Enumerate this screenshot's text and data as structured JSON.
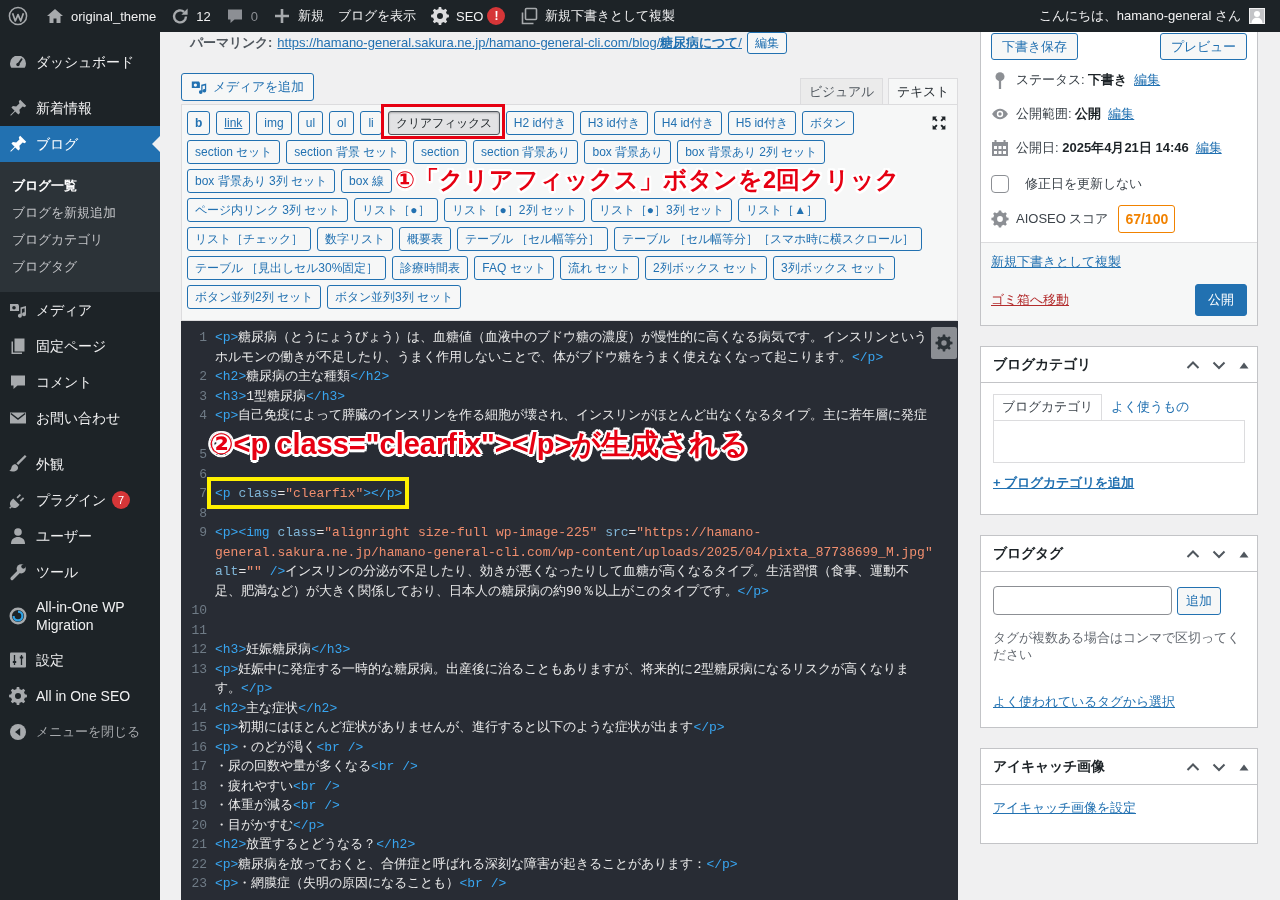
{
  "admin_bar": {
    "site_name": "original_theme",
    "updates": "12",
    "comments": "0",
    "new_label": "新規",
    "view_label": "ブログを表示",
    "seo_label": "SEO",
    "seo_badge": "!",
    "duplicate_label": "新規下書きとして複製",
    "greeting": "こんにちは、hamano-general さん"
  },
  "sidebar": {
    "groups": [
      {
        "items": [
          {
            "label": "ダッシュボード",
            "selected": false
          }
        ]
      },
      {
        "items": [
          {
            "label": "新着情報",
            "selected": false
          },
          {
            "label": "ブログ",
            "selected": true,
            "children": [
              {
                "label": "ブログ一覧",
                "selected": true
              },
              {
                "label": "ブログを新規追加",
                "selected": false
              },
              {
                "label": "ブログカテゴリ",
                "selected": false
              },
              {
                "label": "ブログタグ",
                "selected": false
              }
            ]
          },
          {
            "label": "メディア",
            "selected": false
          },
          {
            "label": "固定ページ",
            "selected": false
          },
          {
            "label": "コメント",
            "selected": false
          },
          {
            "label": "お問い合わせ",
            "selected": false
          }
        ]
      },
      {
        "items": [
          {
            "label": "外観",
            "selected": false
          },
          {
            "label": "プラグイン",
            "selected": false,
            "badge": "7"
          },
          {
            "label": "ユーザー",
            "selected": false
          },
          {
            "label": "ツール",
            "selected": false
          },
          {
            "label": "All-in-One WP Migration",
            "selected": false
          },
          {
            "label": "設定",
            "selected": false
          },
          {
            "label": "All in One SEO",
            "selected": false
          }
        ]
      }
    ],
    "collapse_label": "メニューを閉じる"
  },
  "permalink": {
    "label": "パーマリンク:",
    "url": "https://hamano-general.sakura.ne.jp/hamano-general-cli.com/blog/**糖尿病につて**/",
    "edit_button": "編集"
  },
  "editor": {
    "add_media": "メディアを追加",
    "tabs": [
      {
        "label": "ビジュアル",
        "selected": false
      },
      {
        "label": "テキスト",
        "selected": true
      }
    ],
    "toolbar": {
      "rows": [
        {
          "buttons": [
            {
              "label": "b",
              "pressed": false,
              "framed": false
            },
            {
              "label": "link",
              "pressed": false,
              "framed": false
            },
            {
              "label": "img",
              "pressed": false,
              "framed": false
            },
            {
              "label": "ul",
              "pressed": false,
              "framed": false
            },
            {
              "label": "ol",
              "pressed": false,
              "framed": false
            },
            {
              "label": "li",
              "pressed": false,
              "framed": false
            },
            {
              "label": "クリアフィックス",
              "pressed": true,
              "framed": true
            },
            {
              "label": "H2 id付き",
              "pressed": false,
              "framed": false
            },
            {
              "label": "H3 id付き",
              "pressed": false,
              "framed": false
            },
            {
              "label": "H4 id付き",
              "pressed": false,
              "framed": false
            },
            {
              "label": "H5 id付き",
              "pressed": false,
              "framed": false
            },
            {
              "label": "ボタン",
              "pressed": false,
              "framed": false
            }
          ]
        },
        {
          "buttons": [
            {
              "label": "section セット",
              "pressed": false,
              "framed": false
            },
            {
              "label": "section 背景 セット",
              "pressed": false,
              "framed": false
            },
            {
              "label": "section",
              "pressed": false,
              "framed": false
            },
            {
              "label": "section 背景あり",
              "pressed": false,
              "framed": false
            },
            {
              "label": "box 背景あり",
              "pressed": false,
              "framed": false
            },
            {
              "label": "box 背景あり 2列 セット",
              "pressed": false,
              "framed": false
            }
          ]
        },
        {
          "buttons": [
            {
              "label": "box 背景あり 3列 セット",
              "pressed": false,
              "framed": false
            },
            {
              "label": "box 線",
              "pressed": false,
              "framed": false
            }
          ]
        },
        {
          "buttons": [
            {
              "label": "ページ内リンク 3列 セット",
              "pressed": false,
              "framed": false
            },
            {
              "label": "リスト［●］",
              "pressed": false,
              "framed": false
            },
            {
              "label": "リスト［●］2列 セット",
              "pressed": false,
              "framed": false
            },
            {
              "label": "リスト［●］3列 セット",
              "pressed": false,
              "framed": false
            },
            {
              "label": "リスト［▲］",
              "pressed": false,
              "framed": false
            }
          ]
        },
        {
          "buttons": [
            {
              "label": "リスト［チェック］",
              "pressed": false,
              "framed": false
            },
            {
              "label": "数字リスト",
              "pressed": false,
              "framed": false
            },
            {
              "label": "概要表",
              "pressed": false,
              "framed": false
            },
            {
              "label": "テーブル ［セル幅等分］",
              "pressed": false,
              "framed": false
            },
            {
              "label": "テーブル ［セル幅等分］［スマホ時に横スクロール］",
              "pressed": false,
              "framed": false
            }
          ]
        },
        {
          "buttons": [
            {
              "label": "テーブル ［見出しセル30%固定］",
              "pressed": false,
              "framed": false
            },
            {
              "label": "診療時間表",
              "pressed": false,
              "framed": false
            },
            {
              "label": "FAQ セット",
              "pressed": false,
              "framed": false
            },
            {
              "label": "流れ セット",
              "pressed": false,
              "framed": false
            },
            {
              "label": "2列ボックス セット",
              "pressed": false,
              "framed": false
            },
            {
              "label": "3列ボックス セット",
              "pressed": false,
              "framed": false
            }
          ]
        },
        {
          "buttons": [
            {
              "label": "ボタン並列2列 セット",
              "pressed": false,
              "framed": false
            },
            {
              "label": "ボタン並列3列 セット",
              "pressed": false,
              "framed": false
            }
          ]
        }
      ],
      "callout": "①「クリアフィックス」ボタンを2回クリック"
    },
    "code": {
      "lines": [
        {
          "kind": "code",
          "number": "1",
          "code": "<p>糖尿病（とうにょうびょう）は、血糖値（血液中のブドウ糖の濃度）が慢性的に高くなる病気です。インスリンというホルモンの働きが不足したり、うまく作用しないことで、体がブドウ糖をうまく使えなくなって起こります。</p>",
          "framed": false
        },
        {
          "kind": "code",
          "number": "2",
          "code": "<h2>糖尿病の主な種類</h2>",
          "framed": false
        },
        {
          "kind": "code",
          "number": "3",
          "code": "<h3>1型糖尿病</h3>",
          "framed": false
        },
        {
          "kind": "code",
          "number": "4",
          "code": "<p>自己免疫によって膵臓のインスリンを作る細胞が壊され、インスリンがほとんど出なくなるタイプ。主に若年層に発症",
          "framed": false
        },
        {
          "kind": "covered",
          "framed": false
        },
        {
          "kind": "covered",
          "number": "5",
          "framed": false
        },
        {
          "kind": "code",
          "number": "6",
          "framed": false
        },
        {
          "kind": "code",
          "number": "7",
          "code": "<p class=\"clearfix\"></p>",
          "framed": true
        },
        {
          "kind": "code",
          "number": "8",
          "framed": false
        },
        {
          "kind": "code",
          "number": "9",
          "code": "<p><img class=\"alignright size-full wp-image-225\" src=\"https://hamano-general.sakura.ne.jp/hamano-general-cli.com/wp-content/uploads/2025/04/pixta_87738699_M.jpg\" alt=\"\" />インスリンの分泌が不足したり、効きが悪くなったりして血糖が高くなるタイプ。生活習慣（食事、運動不足、肥満など）が大きく関係しており、日本人の糖尿病の約90％以上がこのタイプです。</p>",
          "framed": false
        },
        {
          "kind": "code",
          "number": "10",
          "framed": false
        },
        {
          "kind": "code",
          "number": "11",
          "framed": false
        },
        {
          "kind": "code",
          "number": "12",
          "code": "<h3>妊娠糖尿病</h3>",
          "framed": false
        },
        {
          "kind": "code",
          "number": "13",
          "code": "<p>妊娠中に発症する一時的な糖尿病。出産後に治ることもありますが、将来的に2型糖尿病になるリスクが高くなります。</p>",
          "framed": false
        },
        {
          "kind": "code",
          "number": "14",
          "code": "<h2>主な症状</h2>",
          "framed": false
        },
        {
          "kind": "code",
          "number": "15",
          "code": "<p>初期にはほとんど症状がありませんが、進行すると以下のような症状が出ます</p>",
          "framed": false
        },
        {
          "kind": "code",
          "number": "16",
          "code": "<p>・のどが渇く<br />",
          "framed": false
        },
        {
          "kind": "code",
          "number": "17",
          "code": "・尿の回数や量が多くなる<br />",
          "framed": false
        },
        {
          "kind": "code",
          "number": "18",
          "code": "・疲れやすい<br />",
          "framed": false
        },
        {
          "kind": "code",
          "number": "19",
          "code": "・体重が減る<br />",
          "framed": false
        },
        {
          "kind": "code",
          "number": "20",
          "code": "・目がかすむ</p>",
          "framed": false
        },
        {
          "kind": "code",
          "number": "21",
          "code": "<h2>放置するとどうなる？</h2>",
          "framed": false
        },
        {
          "kind": "code",
          "number": "22",
          "code": "<p>糖尿病を放っておくと、合併症と呼ばれる深刻な障害が起きることがあります：</p>",
          "framed": false
        },
        {
          "kind": "code",
          "number": "23",
          "code": "<p>・網膜症（失明の原因になることも）<br />",
          "framed": false
        }
      ],
      "callout": "②<p class=\"clearfix\"></p>が生成される"
    }
  },
  "publish_box": {
    "save_draft": "下書き保存",
    "preview": "プレビュー",
    "meta": [
      {
        "label": "ステータス:",
        "value": "下書き",
        "action": "編集"
      },
      {
        "label": "公開範囲:",
        "value": "公開",
        "action": "編集"
      },
      {
        "label": "公開日:",
        "value": "2025年4月21日 14:46",
        "action": "編集"
      }
    ],
    "keep_date": {
      "label": "修正日を更新しない",
      "checked": false
    },
    "seo": {
      "label": "AIOSEO スコア",
      "score": "67/100"
    },
    "duplicate_link": "新規下書きとして複製",
    "trash_link": "ゴミ箱へ移動",
    "publish_button": "公開"
  },
  "category_box": {
    "title": "ブログカテゴリ",
    "tabs": [
      {
        "label": "ブログカテゴリ",
        "selected": true
      },
      {
        "label": "よく使うもの",
        "selected": false
      }
    ],
    "add_link": "+ ブログカテゴリを追加"
  },
  "tag_box": {
    "title": "ブログタグ",
    "add_button": "追加",
    "help": "タグが複数ある場合はコンマで区切ってください",
    "choose_link": "よく使われているタグから選択"
  },
  "featured_box": {
    "title": "アイキャッチ画像",
    "set_link": "アイキャッチ画像を設定"
  }
}
